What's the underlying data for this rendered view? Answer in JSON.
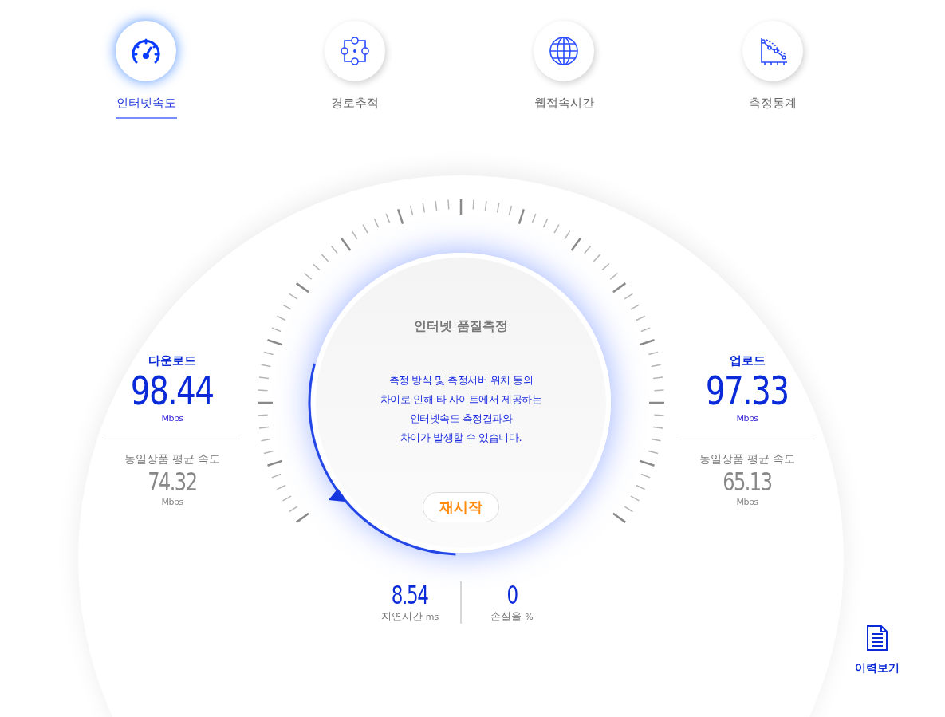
{
  "tabs": [
    {
      "label": "인터넷속도",
      "kind": "gauge",
      "selected": true
    },
    {
      "label": "경로추적",
      "kind": "route",
      "selected": false
    },
    {
      "label": "웹접속시간",
      "kind": "globe",
      "selected": false
    },
    {
      "label": "측정통계",
      "kind": "chart",
      "selected": false
    }
  ],
  "gauge": {
    "title": "인터넷 품질측정",
    "notice": [
      "측정 방식 및 측정서버 위치 등의",
      "차이로 인해 타 사이트에서 제공하는",
      "인터넷속도 측정결과와",
      "차이가 발생할 수 있습니다."
    ],
    "restart_button": "재시작"
  },
  "download": {
    "label": "다운로드",
    "value": "98.44",
    "unit": "Mbps",
    "average_label": "동일상품 평균 속도",
    "average_value": "74.32",
    "average_unit": "Mbps"
  },
  "upload": {
    "label": "업로드",
    "value": "97.33",
    "unit": "Mbps",
    "average_label": "동일상품 평균 속도",
    "average_value": "65.13",
    "average_unit": "Mbps"
  },
  "latency": {
    "value": "8.54",
    "label": "지연시간",
    "unit": "ms"
  },
  "loss": {
    "value": "0",
    "label": "손실율",
    "unit": "%"
  },
  "history_button": "이력보기"
}
